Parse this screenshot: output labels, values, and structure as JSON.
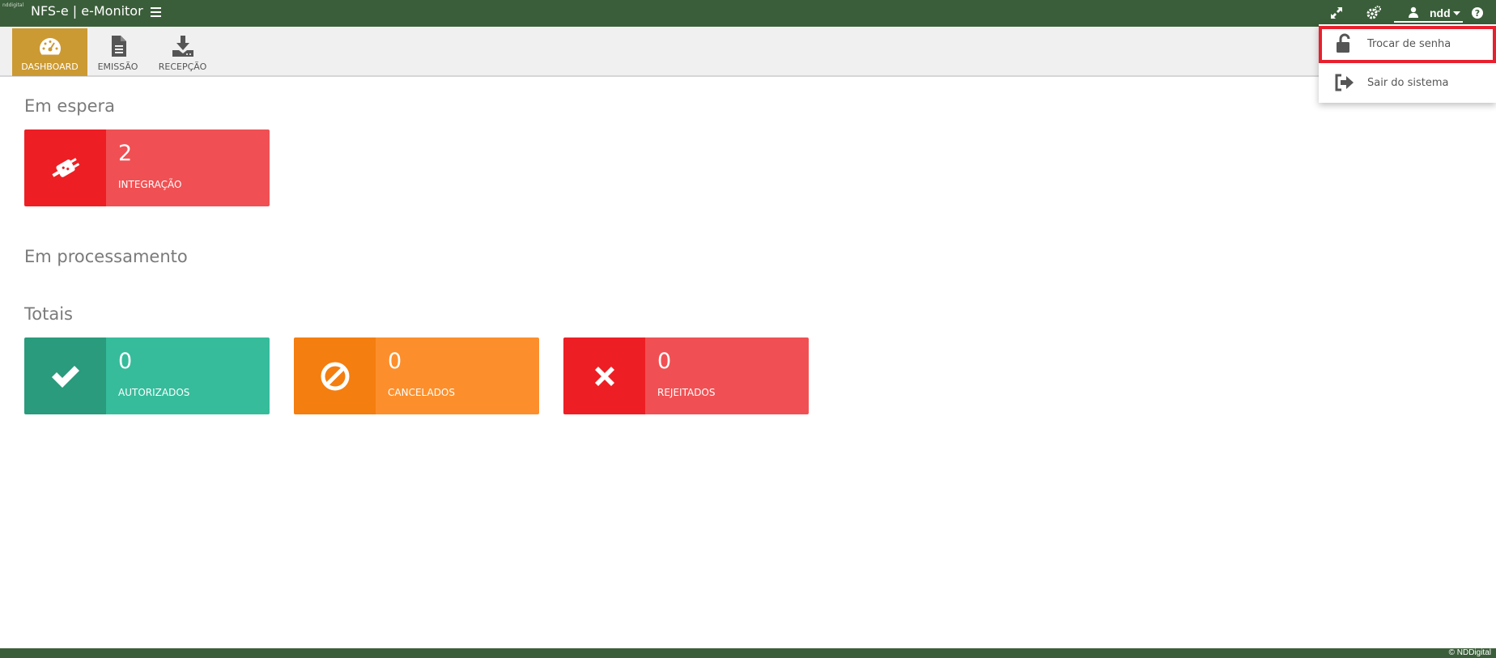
{
  "header": {
    "logo_text": "nddigital",
    "app_title": "NFS-e | e-Monitor",
    "user_name": "ndd"
  },
  "modules": [
    {
      "label": "DASHBOARD",
      "icon": "dashboard-gauge-icon",
      "active": true
    },
    {
      "label": "EMISSÃO",
      "icon": "document-icon",
      "active": false
    },
    {
      "label": "RECEPÇÃO",
      "icon": "download-icon",
      "active": false
    }
  ],
  "sections": {
    "waiting": {
      "title": "Em espera",
      "cards": [
        {
          "count": "2",
          "label": "INTEGRAÇÃO",
          "icon": "plug-icon",
          "icon_color": "#ed1f24",
          "body_color": "#f05053"
        }
      ]
    },
    "processing": {
      "title": "Em processamento"
    },
    "totals": {
      "title": "Totais",
      "cards": [
        {
          "count": "0",
          "label": "AUTORIZADOS",
          "icon": "check-icon",
          "icon_color": "#2a9b7d",
          "body_color": "#36bc9b"
        },
        {
          "count": "0",
          "label": "CANCELADOS",
          "icon": "ban-icon",
          "icon_color": "#f47e0f",
          "body_color": "#fc8f2c"
        },
        {
          "count": "0",
          "label": "REJEITADOS",
          "icon": "times-icon",
          "icon_color": "#ed1f24",
          "body_color": "#f05053"
        }
      ]
    }
  },
  "user_dropdown": {
    "items": [
      {
        "label": "Trocar de senha",
        "icon": "unlock-icon",
        "highlighted": true
      },
      {
        "label": "Sair do sistema",
        "icon": "sign-out-icon",
        "highlighted": false
      }
    ]
  },
  "footer": {
    "copyright": "© NDDigital"
  },
  "colors": {
    "header_green": "#3b5e3a",
    "active_module": "#cc9a33",
    "highlight_border": "#e8202e"
  }
}
